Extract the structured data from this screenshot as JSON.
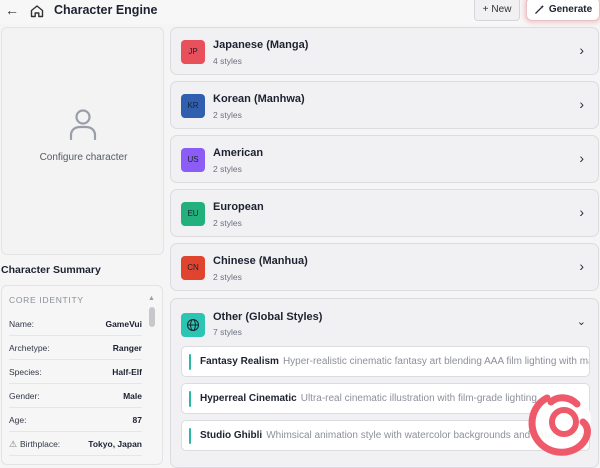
{
  "header": {
    "back_icon": "arrow-left-icon",
    "home_icon": "home-icon",
    "title": "Character Engine",
    "new_label": "New",
    "generate_label": "Generate"
  },
  "left": {
    "configure_label": "Configure character",
    "summary_title": "Character Summary",
    "core_identity_label": "CORE IDENTITY",
    "fields": [
      {
        "key": "Name:",
        "value": "GameVui"
      },
      {
        "key": "Archetype:",
        "value": "Ranger"
      },
      {
        "key": "Species:",
        "value": "Half-Elf"
      },
      {
        "key": "Gender:",
        "value": "Male"
      },
      {
        "key": "Age:",
        "value": "87"
      },
      {
        "key": "Birthplace:",
        "value": "Tokyo, Japan"
      }
    ]
  },
  "categories": [
    {
      "code": "JP",
      "name": "Japanese (Manga)",
      "count": "4 styles",
      "color": "#e8505b"
    },
    {
      "code": "KR",
      "name": "Korean (Manhwa)",
      "count": "2 styles",
      "color": "#2f5fae"
    },
    {
      "code": "US",
      "name": "American",
      "count": "2 styles",
      "color": "#8b5cf6"
    },
    {
      "code": "EU",
      "name": "European",
      "count": "2 styles",
      "color": "#22b07d"
    },
    {
      "code": "CN",
      "name": "Chinese (Manhua)",
      "count": "2 styles",
      "color": "#e0442f"
    }
  ],
  "other": {
    "name": "Other (Global Styles)",
    "count": "7 styles",
    "icon": "globe-icon",
    "color": "#2cc5b4",
    "styles": [
      {
        "title": "Fantasy Realism",
        "desc": "Hyper-realistic cinematic fantasy art blending AAA film lighting with ma..."
      },
      {
        "title": "Hyperreal Cinematic",
        "desc": "Ultra-real cinematic illustration with film-grade lighting... textur..."
      },
      {
        "title": "Studio Ghibli",
        "desc": "Whimsical animation style with watercolor backgrounds and natural scenes"
      }
    ]
  }
}
